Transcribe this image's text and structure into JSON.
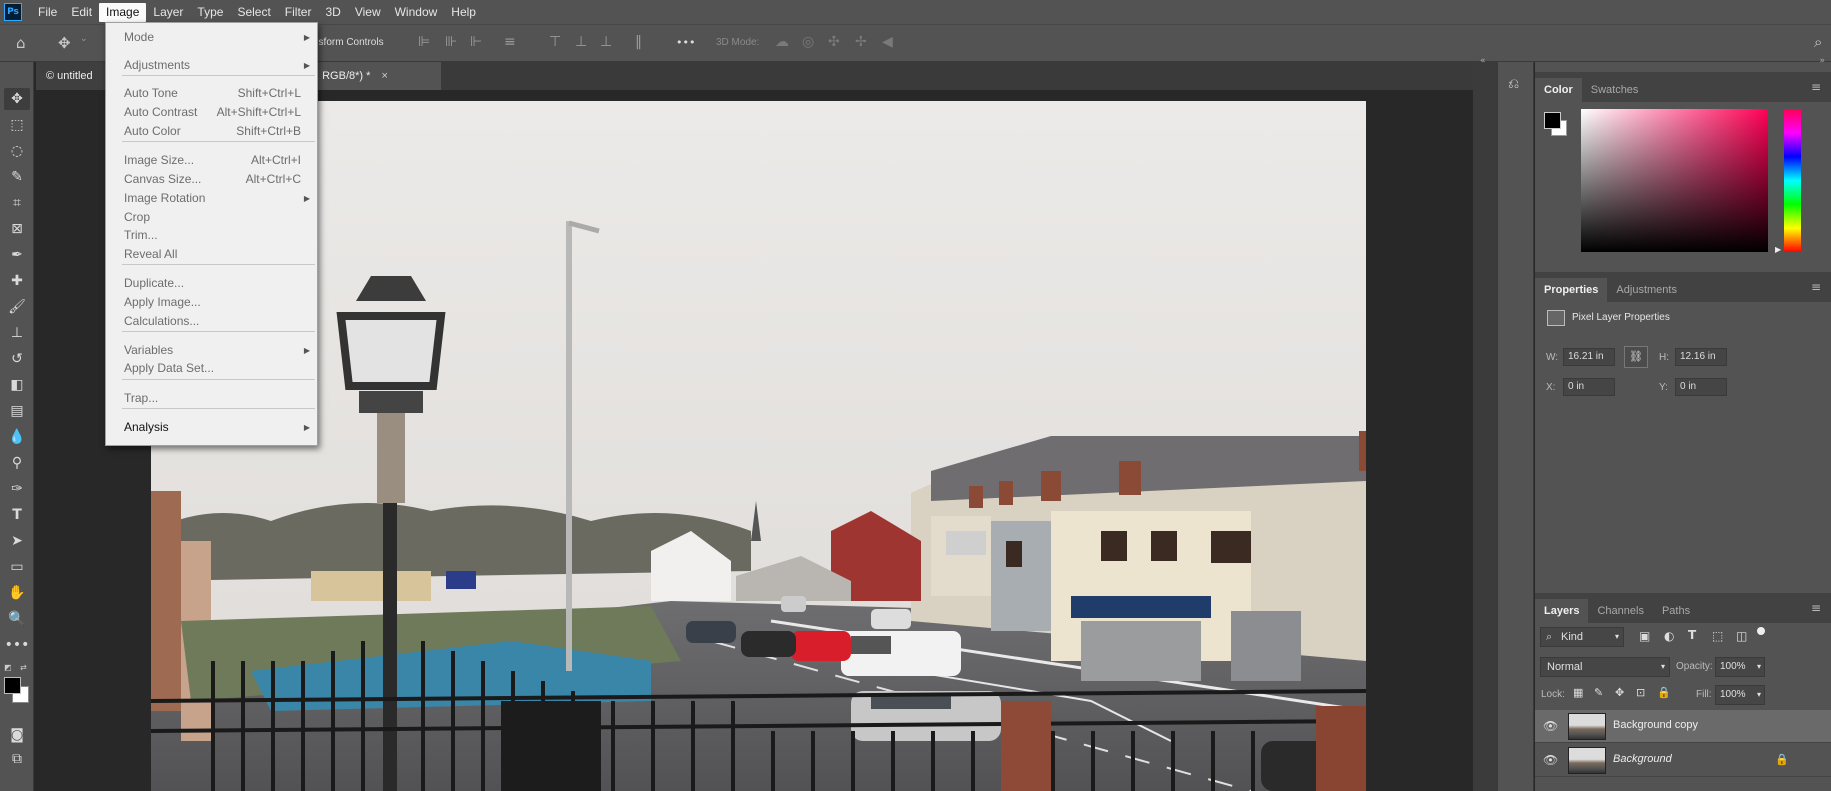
{
  "app": {
    "logo": "Ps"
  },
  "menubar": [
    "File",
    "Edit",
    "Image",
    "Layer",
    "Type",
    "Select",
    "Filter",
    "3D",
    "View",
    "Window",
    "Help"
  ],
  "menubar_active": "Image",
  "optbar": {
    "transform_controls": "nsform Controls",
    "mode_3d": "3D Mode:",
    "more": "•••"
  },
  "tabs": {
    "first": "© untitled",
    "second": ", RGB/8*) *",
    "close": "×"
  },
  "image_menu": {
    "items": [
      {
        "label": "Mode",
        "shortcut": "",
        "submenu": true
      },
      {
        "label": "Adjustments",
        "shortcut": "",
        "submenu": true
      },
      {
        "label": "Auto Tone",
        "shortcut": "Shift+Ctrl+L",
        "submenu": false
      },
      {
        "label": "Auto Contrast",
        "shortcut": "Alt+Shift+Ctrl+L",
        "submenu": false
      },
      {
        "label": "Auto Color",
        "shortcut": "Shift+Ctrl+B",
        "submenu": false
      },
      {
        "label": "Image Size...",
        "shortcut": "Alt+Ctrl+I",
        "submenu": false
      },
      {
        "label": "Canvas Size...",
        "shortcut": "Alt+Ctrl+C",
        "submenu": false
      },
      {
        "label": "Image Rotation",
        "shortcut": "",
        "submenu": true
      },
      {
        "label": "Crop",
        "shortcut": "",
        "submenu": false
      },
      {
        "label": "Trim...",
        "shortcut": "",
        "submenu": false
      },
      {
        "label": "Reveal All",
        "shortcut": "",
        "submenu": false
      },
      {
        "label": "Duplicate...",
        "shortcut": "",
        "submenu": false
      },
      {
        "label": "Apply Image...",
        "shortcut": "",
        "submenu": false
      },
      {
        "label": "Calculations...",
        "shortcut": "",
        "submenu": false
      },
      {
        "label": "Variables",
        "shortcut": "",
        "submenu": true
      },
      {
        "label": "Apply Data Set...",
        "shortcut": "",
        "submenu": false
      },
      {
        "label": "Trap...",
        "shortcut": "",
        "submenu": false
      },
      {
        "label": "Analysis",
        "shortcut": "",
        "submenu": true,
        "highlight": true
      }
    ]
  },
  "color_panel": {
    "tabs": [
      "Color",
      "Swatches"
    ],
    "foreground": "#000000",
    "background": "#ffffff",
    "hue": "#ff0055"
  },
  "properties_panel": {
    "tabs": [
      "Properties",
      "Adjustments"
    ],
    "heading": "Pixel Layer Properties",
    "w_label": "W:",
    "w_value": "16.21 in",
    "h_label": "H:",
    "h_value": "12.16 in",
    "x_label": "X:",
    "x_value": "0 in",
    "y_label": "Y:",
    "y_value": "0 in"
  },
  "layers_panel": {
    "tabs": [
      "Layers",
      "Channels",
      "Paths"
    ],
    "filter_kind": "Kind",
    "blend_mode": "Normal",
    "opacity_label": "Opacity:",
    "opacity_value": "100%",
    "lock_label": "Lock:",
    "fill_label": "Fill:",
    "fill_value": "100%",
    "layers": [
      {
        "name": "Background copy",
        "selected": true
      },
      {
        "name": "Background",
        "selected": false,
        "locked": true
      }
    ]
  }
}
